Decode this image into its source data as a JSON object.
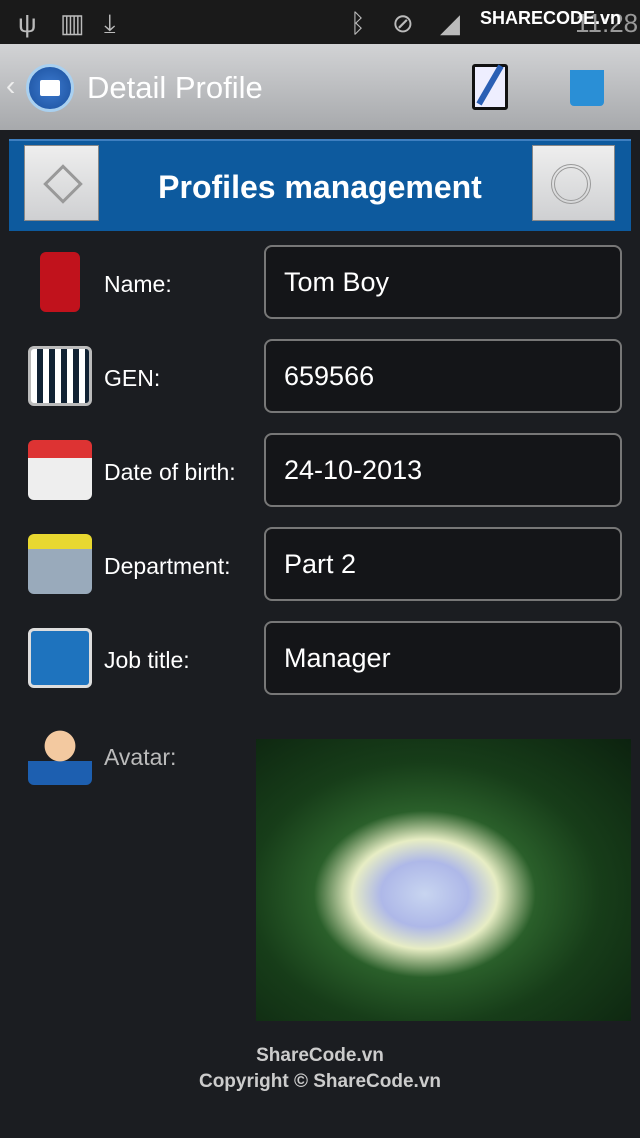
{
  "status_bar": {
    "time": "11:28",
    "watermark": "SHARECODE.vn",
    "icons": [
      "usb-icon",
      "sd-card-icon",
      "download-icon",
      "bluetooth-icon",
      "mute-icon",
      "signal-icon",
      "battery-icon"
    ]
  },
  "action_bar": {
    "title": "Detail Profile",
    "edit_icon": "notepad-edit-icon",
    "delete_icon": "trash-icon"
  },
  "banner": {
    "title": "Profiles management",
    "bg": "#0d5a9e"
  },
  "fields": [
    {
      "label": "Name:",
      "value": "Tom Boy",
      "icon": "name-tag-icon"
    },
    {
      "label": "GEN:",
      "value": "659566",
      "icon": "qr-code-icon"
    },
    {
      "label": "Date of birth:",
      "value": "24-10-2013",
      "icon": "calendar-clock-icon"
    },
    {
      "label": "Department:",
      "value": "Part 2",
      "icon": "workers-icon"
    },
    {
      "label": "Job title:",
      "value": "Manager",
      "icon": "id-card-icon"
    }
  ],
  "avatar": {
    "label": "Avatar:",
    "icon": "user-icon"
  },
  "footer": {
    "line1": "ShareCode.vn",
    "line2": "Copyright © ShareCode.vn"
  }
}
